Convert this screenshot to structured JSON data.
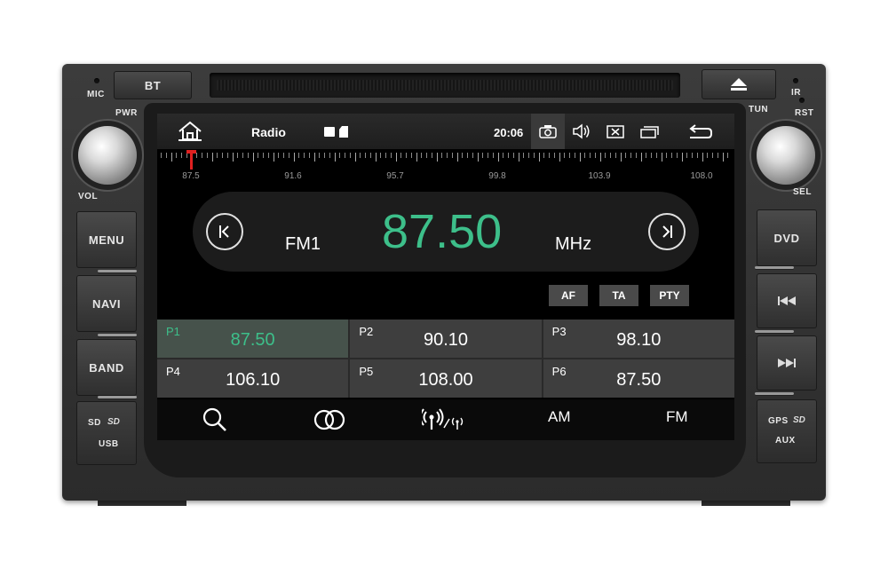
{
  "hardware": {
    "bt_label": "BT",
    "mic_label": "MIC",
    "pwr_label": "PWR",
    "vol_label": "VOL",
    "ir_label": "IR",
    "rst_label": "RST",
    "tun_label": "TUN",
    "sel_label": "SEL",
    "left_buttons": [
      "MENU",
      "NAVI",
      "BAND"
    ],
    "sd_label": "SD",
    "usb_label": "USB",
    "right_buttons": {
      "dvd": "DVD",
      "prev": "⏮",
      "next": "⏭"
    },
    "gps_label": "GPS",
    "aux_label": "AUX"
  },
  "statusbar": {
    "title": "Radio",
    "time": "20:06"
  },
  "tuner": {
    "scale_labels": [
      "87.5",
      "91.6",
      "95.7",
      "99.8",
      "103.9",
      "108.0"
    ],
    "band": "FM1",
    "frequency": "87.50",
    "unit": "MHz"
  },
  "rds_buttons": [
    "AF",
    "TA",
    "PTY"
  ],
  "presets": [
    {
      "label": "P1",
      "freq": "87.50",
      "active": true
    },
    {
      "label": "P2",
      "freq": "90.10",
      "active": false
    },
    {
      "label": "P3",
      "freq": "98.10",
      "active": false
    },
    {
      "label": "P4",
      "freq": "106.10",
      "active": false
    },
    {
      "label": "P5",
      "freq": "108.00",
      "active": false
    },
    {
      "label": "P6",
      "freq": "87.50",
      "active": false
    }
  ],
  "bottombar": {
    "am_label": "AM",
    "fm_label": "FM"
  },
  "colors": {
    "accent": "#3dbf8a",
    "needle": "#e02020"
  }
}
